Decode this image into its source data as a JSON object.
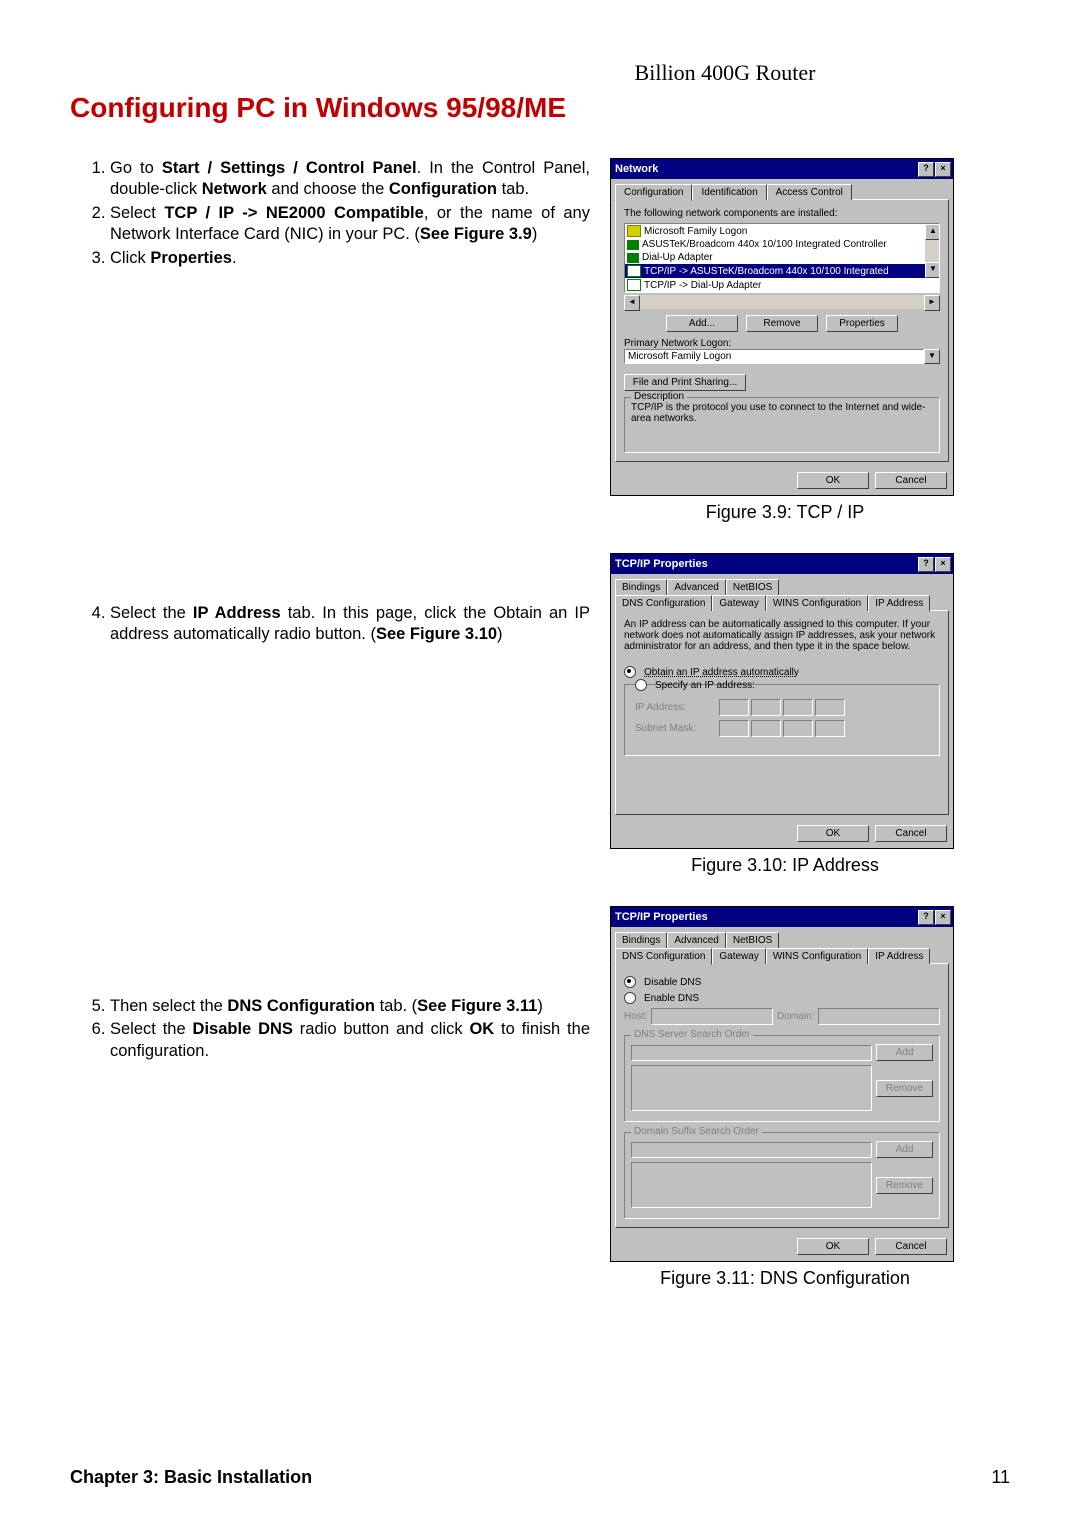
{
  "header_right": "Billion 400G Router",
  "section_title": "Configuring PC in Windows 95/98/ME",
  "steps_group1": [
    "Go to <b>Start / Settings / Control Panel</b>. In the Control Panel, double-click <b>Network</b> and choose the <b>Configuration</b> tab.",
    "Select <b>TCP / IP -> NE2000 Compatible</b>, or the name of any Network Interface Card (NIC) in your PC. (<b>See Figure 3.9</b>)",
    "Click <b>Properties</b>."
  ],
  "steps_group2": [
    "Select the <b>IP Address</b> tab. In this page, click the Obtain an IP address automatically radio button. (<b>See Figure 3.10</b>)"
  ],
  "steps_group3": [
    "Then select the <b>DNS Configuration</b> tab. (<b>See Figure 3.11</b>)",
    "Select the <b>Disable DNS</b> radio button and click <b>OK</b> to finish the configuration."
  ],
  "fig39": {
    "title": "Network",
    "tabs": [
      "Configuration",
      "Identification",
      "Access Control"
    ],
    "list_label": "The following network components are installed:",
    "items": [
      "Microsoft Family Logon",
      "ASUSTeK/Broadcom 440x 10/100 Integrated Controller",
      "Dial-Up Adapter",
      "TCP/IP -> ASUSTeK/Broadcom 440x 10/100 Integrated",
      "TCP/IP -> Dial-Up Adapter"
    ],
    "buttons": [
      "Add...",
      "Remove",
      "Properties"
    ],
    "primary_label": "Primary Network Logon:",
    "primary_value": "Microsoft Family Logon",
    "file_print": "File and Print Sharing...",
    "desc_legend": "Description",
    "desc_text": "TCP/IP is the protocol you use to connect to the Internet and wide-area networks.",
    "ok": "OK",
    "cancel": "Cancel",
    "caption": "Figure 3.9: TCP / IP"
  },
  "fig310": {
    "title": "TCP/IP Properties",
    "tabs_row1": [
      "Bindings",
      "Advanced",
      "NetBIOS"
    ],
    "tabs_row2": [
      "DNS Configuration",
      "Gateway",
      "WINS Configuration",
      "IP Address"
    ],
    "desc": "An IP address can be automatically assigned to this computer. If your network does not automatically assign IP addresses, ask your network administrator for an address, and then type it in the space below.",
    "opt1": "Obtain an IP address automatically",
    "opt2": "Specify an IP address:",
    "ip_label": "IP Address:",
    "mask_label": "Subnet Mask:",
    "ok": "OK",
    "cancel": "Cancel",
    "caption": "Figure 3.10: IP Address"
  },
  "fig311": {
    "title": "TCP/IP Properties",
    "tabs_row1": [
      "Bindings",
      "Advanced",
      "NetBIOS"
    ],
    "tabs_row2": [
      "DNS Configuration",
      "Gateway",
      "WINS Configuration",
      "IP Address"
    ],
    "opt1": "Disable DNS",
    "opt2": "Enable DNS",
    "host": "Host:",
    "domain": "Domain:",
    "dns_order": "DNS Server Search Order",
    "domain_order": "Domain Suffix Search Order",
    "add": "Add",
    "remove": "Remove",
    "ok": "OK",
    "cancel": "Cancel",
    "caption": "Figure 3.11: DNS Configuration"
  },
  "page_number": "11",
  "chapter": "Chapter 3: Basic Installation"
}
